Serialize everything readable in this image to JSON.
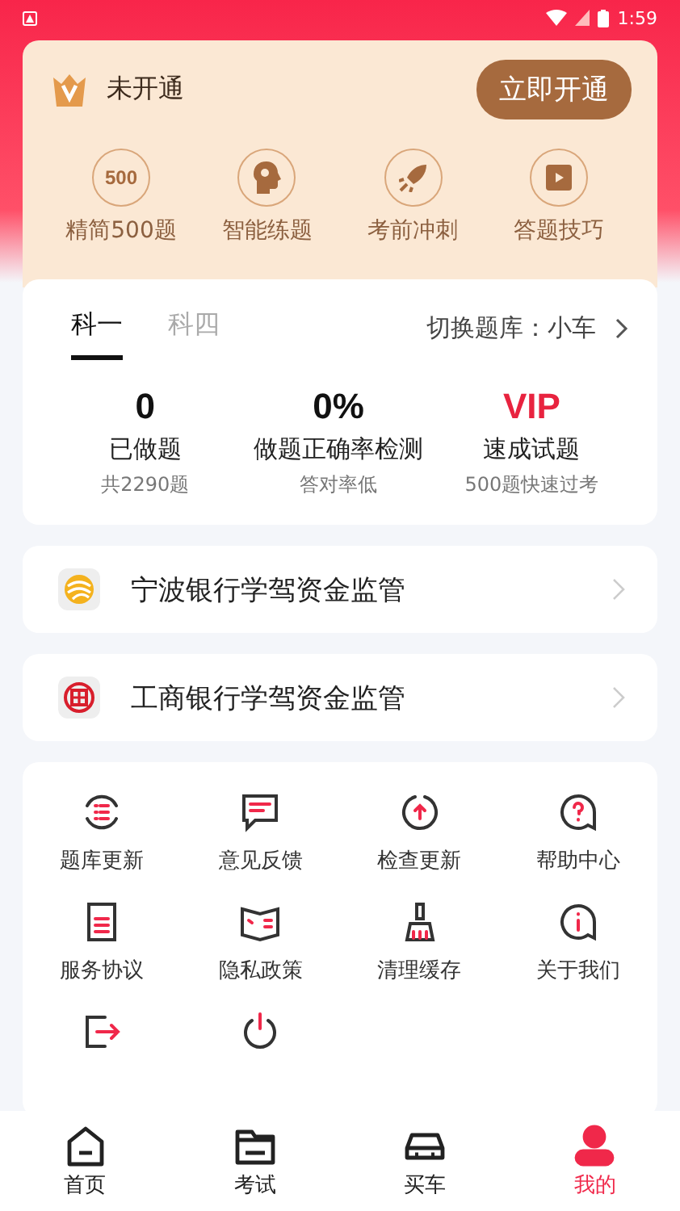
{
  "status_bar": {
    "time": "1:59"
  },
  "vip_card": {
    "status": "未开通",
    "button": "立即开通",
    "features": [
      {
        "label": "精简500题",
        "badge": "500"
      },
      {
        "label": "智能练题"
      },
      {
        "label": "考前冲刺"
      },
      {
        "label": "答题技巧"
      }
    ]
  },
  "stats_card": {
    "tabs": [
      {
        "label": "科一",
        "selected": true
      },
      {
        "label": "科四",
        "selected": false
      }
    ],
    "switch_bank": "切换题库：小车",
    "stats": [
      {
        "value": "0",
        "label": "已做题",
        "note": "共2290题",
        "highlight": false
      },
      {
        "value": "0%",
        "label": "做题正确率检测",
        "note": "答对率低",
        "highlight": false
      },
      {
        "value": "VIP",
        "label": "速成试题",
        "note": "500题快速过考",
        "highlight": true
      }
    ]
  },
  "bank_rows": [
    {
      "label": "宁波银行学驾资金监管",
      "kind": "ningbo"
    },
    {
      "label": "工商银行学驾资金监管",
      "kind": "icbc"
    }
  ],
  "menu": [
    {
      "label": "题库更新"
    },
    {
      "label": "意见反馈"
    },
    {
      "label": "检查更新"
    },
    {
      "label": "帮助中心"
    },
    {
      "label": "服务协议"
    },
    {
      "label": "隐私政策"
    },
    {
      "label": "清理缓存"
    },
    {
      "label": "关于我们"
    },
    {
      "kind": "icon_only"
    },
    {
      "kind": "icon_only"
    }
  ],
  "bottom_nav": [
    {
      "label": "首页",
      "selected": false
    },
    {
      "label": "考试",
      "selected": false
    },
    {
      "label": "买车",
      "selected": false
    },
    {
      "label": "我的",
      "selected": true
    }
  ]
}
